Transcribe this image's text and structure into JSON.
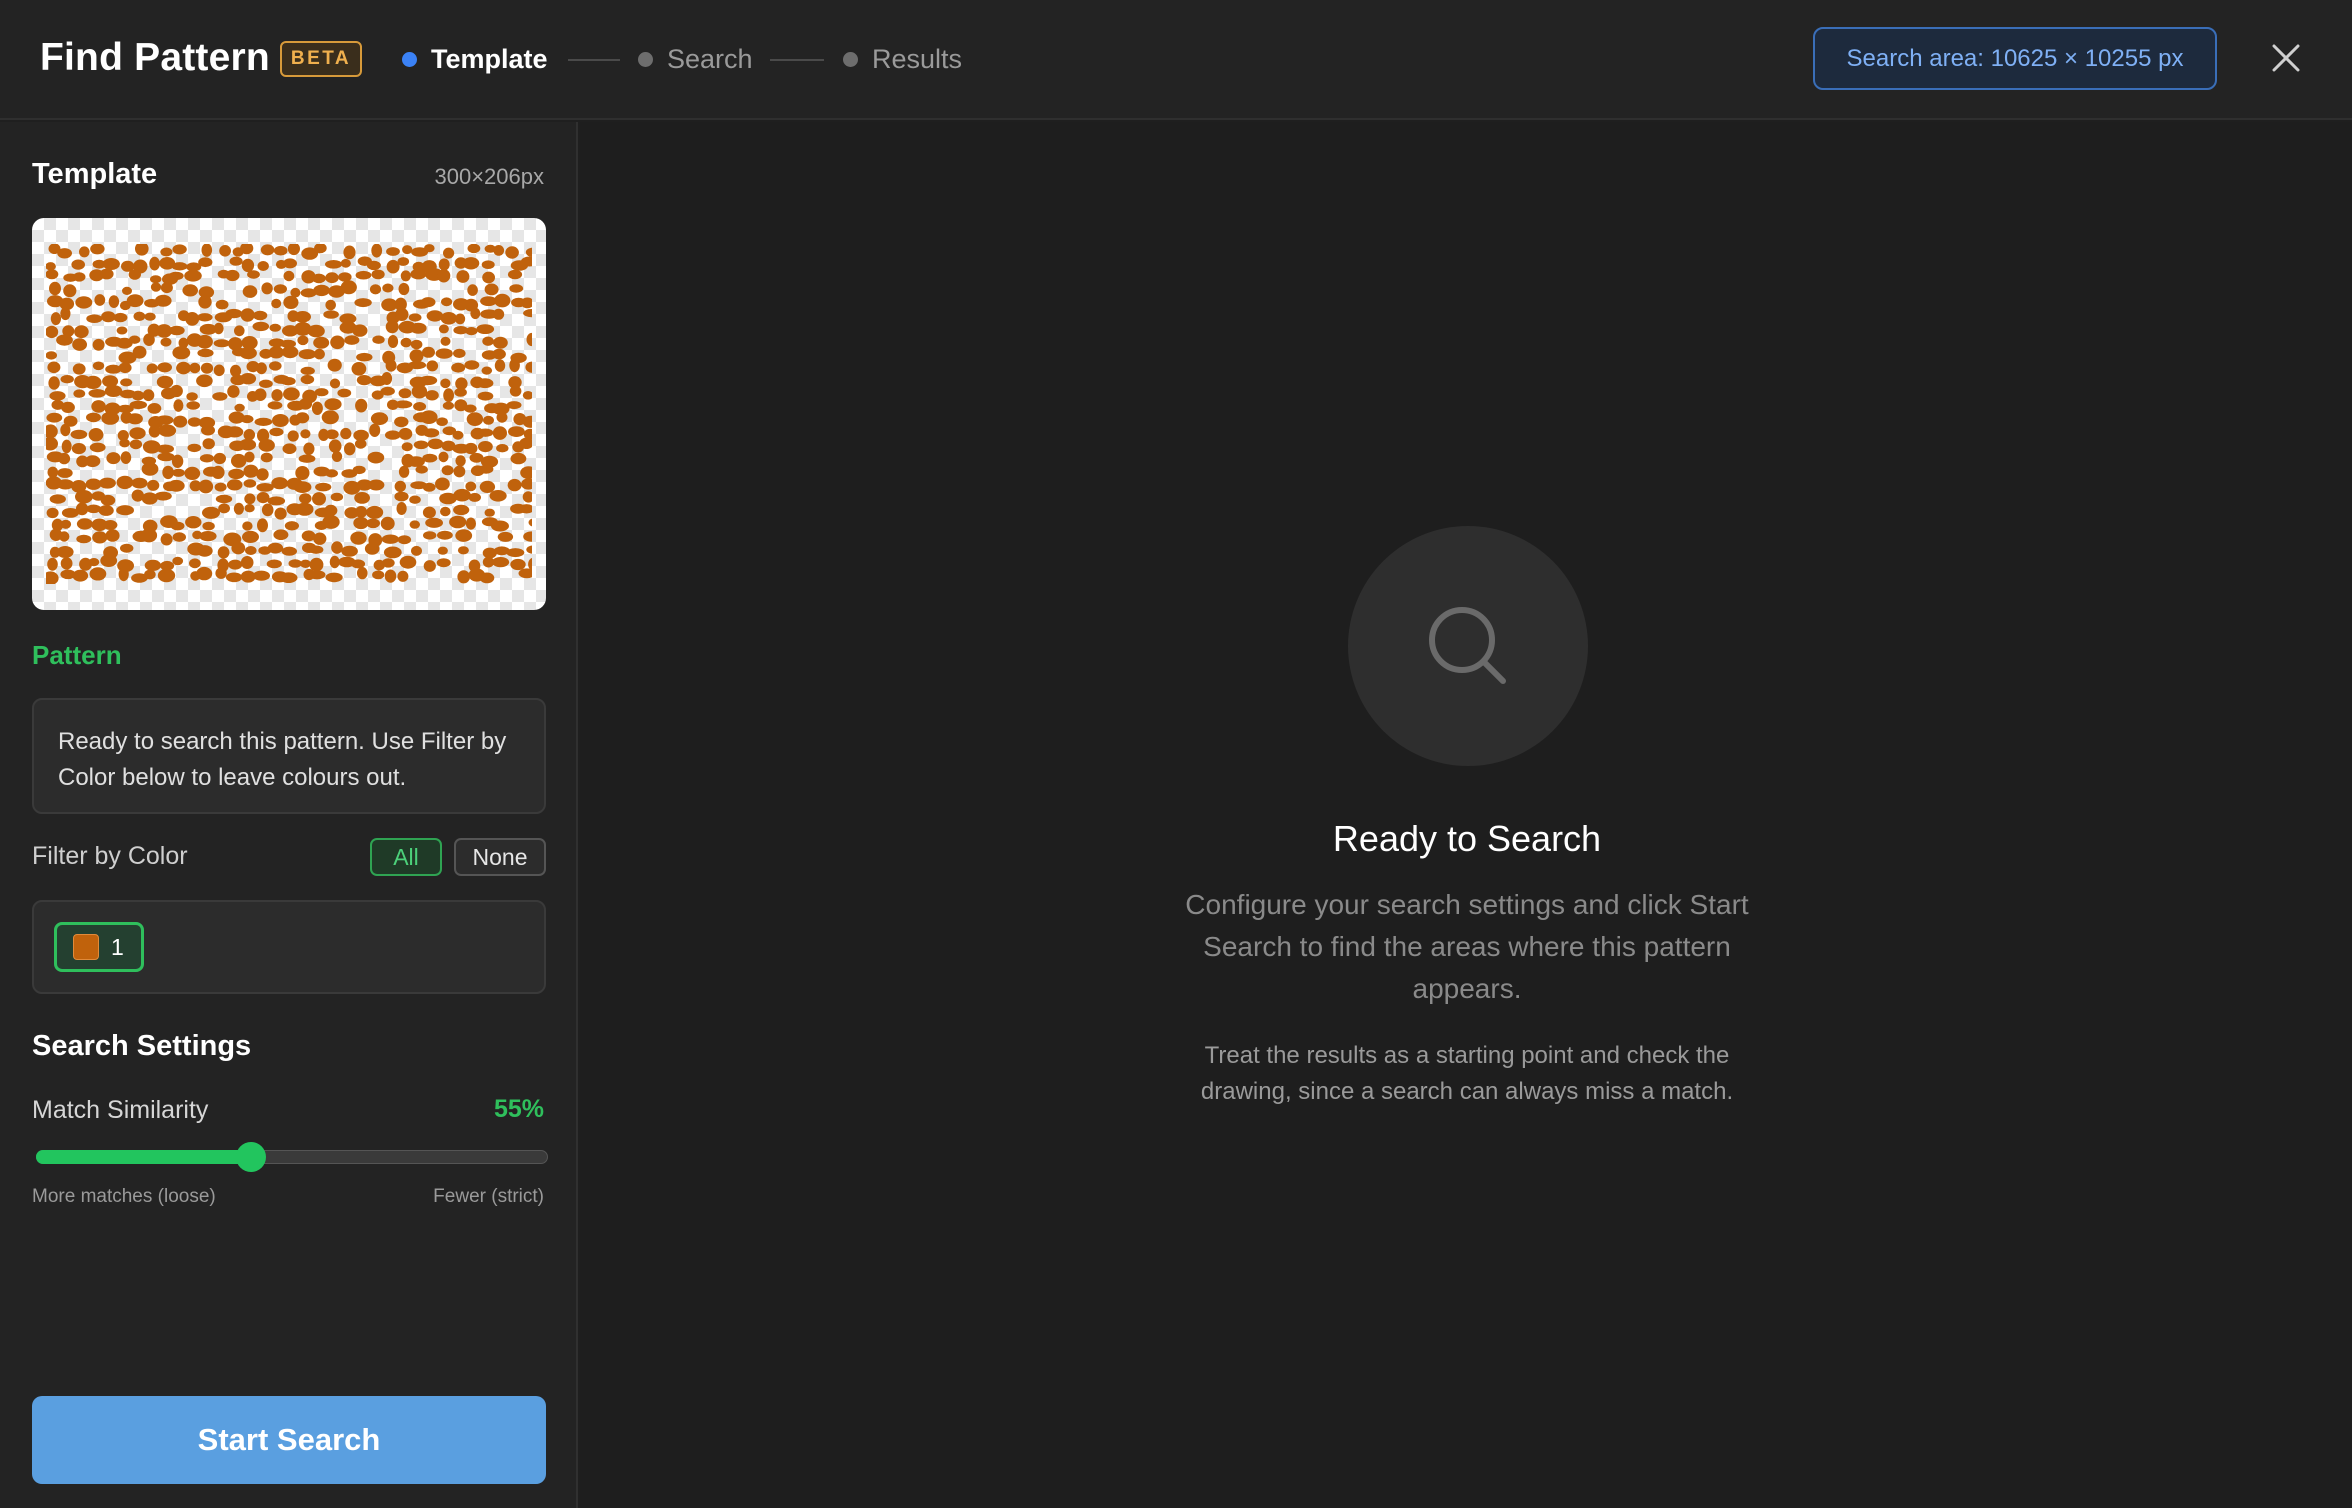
{
  "header": {
    "title": "Find Pattern",
    "badge": "BETA",
    "steps": [
      {
        "label": "Template",
        "state": "active"
      },
      {
        "label": "Search",
        "state": "pending"
      },
      {
        "label": "Results",
        "state": "pending"
      }
    ],
    "search_area": "Search area: 10625 × 10255 px",
    "close_icon": "close-icon"
  },
  "sidebar": {
    "template": {
      "title": "Template",
      "size": "300×206px",
      "preview_icon": "pattern-thumbnail"
    },
    "pattern": {
      "label": "Pattern",
      "info": "Ready to search this pattern. Use Filter by Color below to leave colours out."
    },
    "filter": {
      "label": "Filter by Color",
      "all_label": "All",
      "none_label": "None",
      "colors": [
        {
          "swatch": "#c0620c",
          "count": "1",
          "selected": true
        }
      ]
    },
    "settings": {
      "title": "Search Settings",
      "similarity_label": "Match Similarity",
      "similarity_value": "55%",
      "similarity_fraction": 0.42,
      "hint_loose": "More matches (loose)",
      "hint_strict": "Fewer (strict)"
    },
    "start_button": "Start Search"
  },
  "main": {
    "icon": "search-icon",
    "title": "Ready to Search",
    "description": "Configure your search settings and click Start Search to find the areas where this pattern appears.",
    "note": "Treat the results as a starting point and check the drawing, since a search can always miss a match."
  },
  "colors": {
    "accent_green": "#22c55e",
    "accent_blue": "#3b82f6",
    "primary_button": "#5a9fe0",
    "pattern_color": "#c0620c"
  }
}
